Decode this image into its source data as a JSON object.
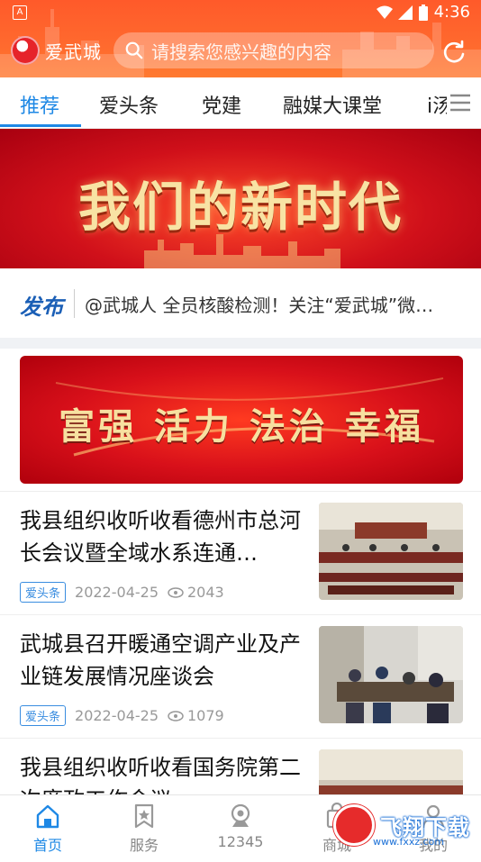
{
  "status": {
    "left_icon": "A",
    "time": "4:36"
  },
  "header": {
    "app_name": "爱武城",
    "search_placeholder": "请搜索您感兴趣的内容"
  },
  "tabs": [
    {
      "label": "推荐"
    },
    {
      "label": "爱头条"
    },
    {
      "label": "党建"
    },
    {
      "label": "融媒大课堂"
    },
    {
      "label": "i汤"
    }
  ],
  "banner1": {
    "text": "我们的新时代"
  },
  "notice": {
    "logo": "发布",
    "text": "@武城人 全员核酸检测！关注“爱武城”微…"
  },
  "banner2": {
    "text": "富强 活力 法治 幸福"
  },
  "articles": [
    {
      "title": "我县组织收听收看德州市总河长会议暨全域水系连通…",
      "tag": "爱头条",
      "date": "2022-04-25",
      "views": "2043"
    },
    {
      "title": "武城县召开暖通空调产业及产业链发展情况座谈会",
      "tag": "爱头条",
      "date": "2022-04-25",
      "views": "1079"
    },
    {
      "title": "我县组织收听收看国务院第二次廉政工作会议",
      "tag": "",
      "date": "",
      "views": ""
    }
  ],
  "bottom_nav": [
    {
      "label": "首页",
      "icon": "home-icon"
    },
    {
      "label": "服务",
      "icon": "star-bookmark-icon"
    },
    {
      "label": "12345",
      "icon": "camera-icon"
    },
    {
      "label": "商城",
      "icon": "shop-icon"
    },
    {
      "label": "我的",
      "icon": "user-icon"
    }
  ],
  "watermark": {
    "text": "飞翔下载",
    "sub": "www.fxxz.com"
  },
  "colors": {
    "accent": "#1e88e5",
    "header": "#ff6a2e",
    "banner_red": "#d0101a",
    "gold": "#f8e3a4"
  }
}
